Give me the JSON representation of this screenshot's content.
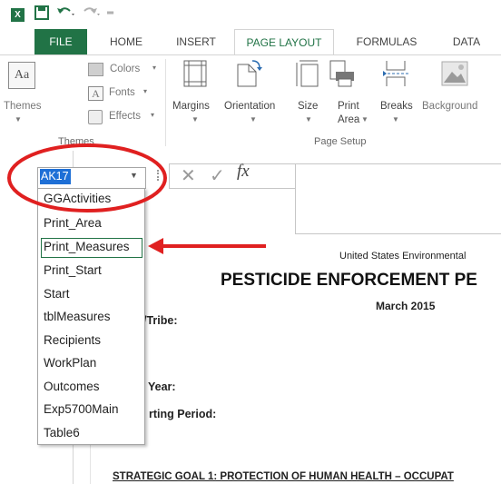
{
  "qat": {
    "logo": "X",
    "save_icon": "save-icon",
    "undo_icon": "undo-icon",
    "redo_icon": "redo-icon",
    "customize_icon": "customize-icon"
  },
  "tabs": [
    {
      "label": "FILE"
    },
    {
      "label": "HOME"
    },
    {
      "label": "INSERT"
    },
    {
      "label": "PAGE LAYOUT"
    },
    {
      "label": "FORMULAS"
    },
    {
      "label": "DATA"
    }
  ],
  "ribbon": {
    "themes": {
      "label": "Themes",
      "colors": "Colors",
      "fonts": "Fonts",
      "effects": "Effects",
      "group": "Themes"
    },
    "margins": "Margins",
    "orientation": "Orientation",
    "size": "Size",
    "print_area": {
      "line1": "Print",
      "line2": "Area"
    },
    "breaks": "Breaks",
    "background": "Background",
    "page_setup_group": "Page Setup",
    "theme_icon_text": "Aa",
    "font_icon_text": "A"
  },
  "formula_bar": {
    "name_box_value": "AK17",
    "cancel": "✕",
    "enter": "✓",
    "fx": "fx"
  },
  "dropdown": {
    "items": [
      "GGActivities",
      "Print_Area",
      "Print_Measures",
      "Print_Start",
      "Start",
      "tblMeasures",
      "Recipients",
      "WorkPlan",
      "Outcomes",
      "Exp5700Main",
      "Table6"
    ],
    "highlighted": "Print_Measures"
  },
  "sheet": {
    "agency": "United States Environmental",
    "title": "PESTICIDE ENFORCEMENT PE",
    "date": "March 2015",
    "tribe": "/Tribe:",
    "year": "Year:",
    "period": "rting Period:",
    "goal": "STRATEGIC GOAL 1: PROTECTION OF HUMAN HEALTH – OCCUPAT"
  },
  "colors": {
    "excel_green": "#217346",
    "annotation_red": "#e02020",
    "selection_blue": "#1e6fd6"
  }
}
